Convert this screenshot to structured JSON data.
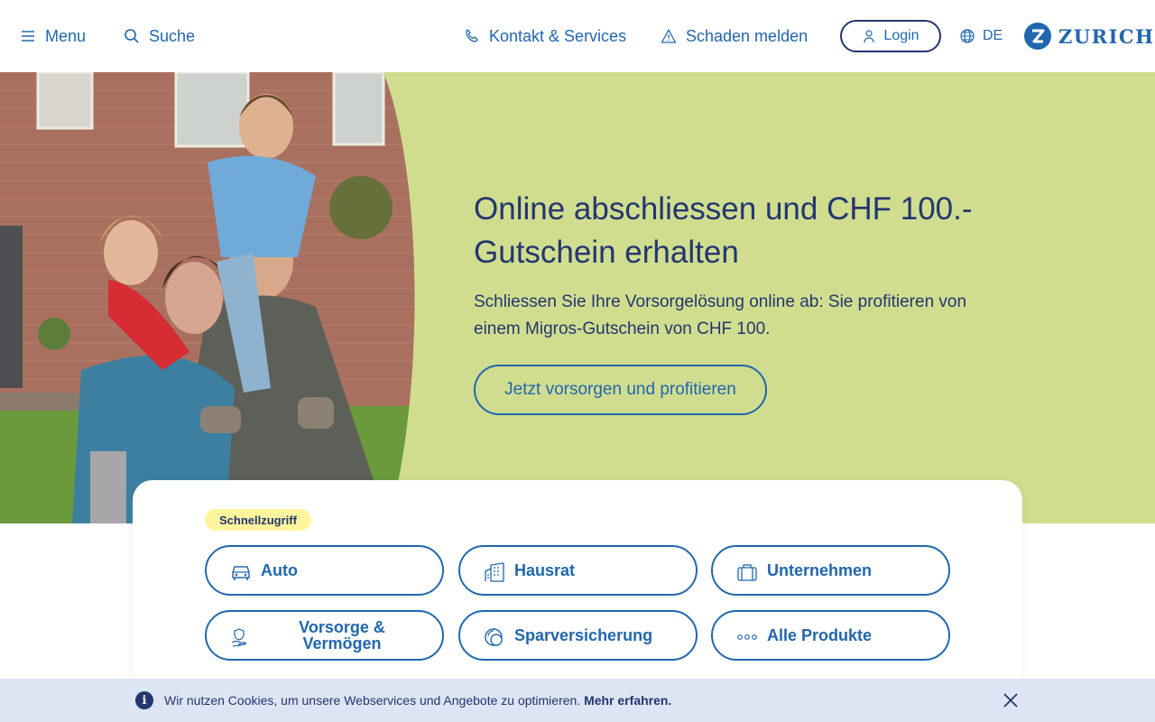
{
  "header": {
    "menu_label": "Menu",
    "search_label": "Suche",
    "contact_label": "Kontakt & Services",
    "claim_label": "Schaden melden",
    "login_label": "Login",
    "language": "DE",
    "logo_text": "ZURICH"
  },
  "hero": {
    "title": "Online abschliessen und CHF 100.- Gutschein erhalten",
    "subtitle": "Schliessen Sie Ihre Vorsorgelösung online ab: Sie profitieren von einem Migros-Gutschein von CHF 100.",
    "cta_label": "Jetzt vorsorgen und profitieren"
  },
  "quick_access": {
    "badge": "Schnellzugriff",
    "buttons": [
      {
        "label": "Auto",
        "icon": "car-icon"
      },
      {
        "label": "Hausrat",
        "icon": "building-icon"
      },
      {
        "label": "Unternehmen",
        "icon": "briefcase-icon"
      },
      {
        "label": "Vorsorge & Vermögen",
        "icon": "hand-shield-icon"
      },
      {
        "label": "Sparversicherung",
        "icon": "savings-icon"
      },
      {
        "label": "Alle Produkte",
        "icon": "dots-icon"
      }
    ]
  },
  "cookie_bar": {
    "text": "Wir nutzen Cookies, um unsere Webservices und Angebote zu optimieren.",
    "link": "Mehr erfahren."
  },
  "colors": {
    "brand_blue": "#2167ae",
    "dark_blue": "#23366f",
    "hero_green": "#d0dd8f",
    "badge_yellow": "#fff59c",
    "cookie_bg": "#dde4f3"
  }
}
